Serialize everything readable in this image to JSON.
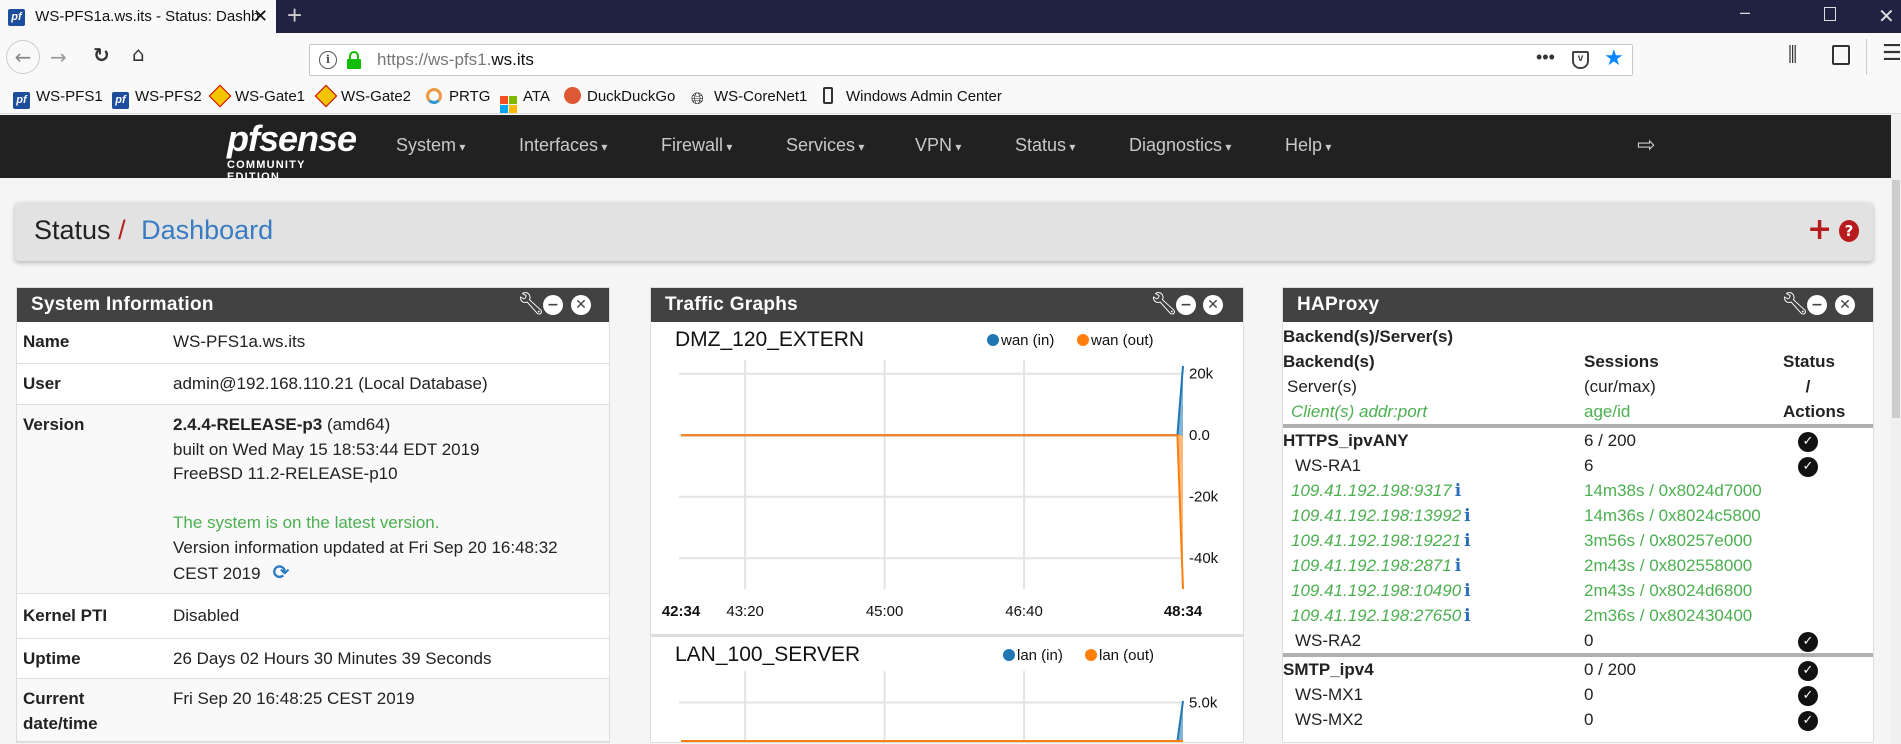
{
  "browser": {
    "tab_title": "WS-PFS1a.ws.its - Status: Dashb",
    "url_scheme": "https://ws-pfs1.",
    "url_domain": "ws.its",
    "bookmarks": [
      {
        "label": "WS-PFS1",
        "icon": "pfsense-icon"
      },
      {
        "label": "WS-PFS2",
        "icon": "pfsense-icon"
      },
      {
        "label": "WS-Gate1",
        "icon": "fritzbox-icon"
      },
      {
        "label": "WS-Gate2",
        "icon": "fritzbox-icon"
      },
      {
        "label": "PRTG",
        "icon": "prtg-icon"
      },
      {
        "label": "ATA",
        "icon": "windows-icon"
      },
      {
        "label": "DuckDuckGo",
        "icon": "duckduckgo-icon"
      },
      {
        "label": "WS-CoreNet1",
        "icon": "globe-icon"
      },
      {
        "label": "Windows Admin Center",
        "icon": "phone-icon"
      }
    ]
  },
  "nav": {
    "logo_text": "pfsense",
    "logo_sub": "COMMUNITY EDITION",
    "menu": [
      "System",
      "Interfaces",
      "Firewall",
      "Services",
      "VPN",
      "Status",
      "Diagnostics",
      "Help"
    ]
  },
  "breadcrumb": {
    "parent": "Status",
    "separator": "/",
    "current": "Dashboard"
  },
  "colors": {
    "accent": "#3a7cc3",
    "danger": "#b71c1c",
    "success": "#4caf50",
    "series_in": "#1f77b4",
    "series_out": "#ff7f0e"
  },
  "system_info": {
    "title": "System Information",
    "rows": [
      {
        "label": "Name",
        "lines": [
          "WS-PFS1a.ws.its"
        ]
      },
      {
        "label": "User",
        "lines": [
          "admin@192.168.110.21 (Local Database)"
        ]
      },
      {
        "label": "Version",
        "version_bold": "2.4.4-RELEASE-p3",
        "version_arch": " (amd64)",
        "built": "built on Wed May 15 18:53:44 EDT 2019",
        "os": "FreeBSD 11.2-RELEASE-p10",
        "status": "The system is on the latest version.",
        "updated_1": "Version information updated at Fri Sep 20 16:48:32",
        "updated_2": "CEST 2019"
      },
      {
        "label": "Kernel PTI",
        "lines": [
          "Disabled"
        ]
      },
      {
        "label": "Uptime",
        "lines": [
          "26 Days 02 Hours 30 Minutes 39 Seconds"
        ]
      },
      {
        "label_1": "Current",
        "label_2": "date/time",
        "lines": [
          "Fri Sep 20 16:48:25 CEST 2019"
        ]
      }
    ]
  },
  "traffic": {
    "title": "Traffic Graphs"
  },
  "chart_data": [
    {
      "type": "area",
      "title": "DMZ_120_EXTERN",
      "x_ticks": [
        "42:34",
        "43:20",
        "45:00",
        "46:40",
        "48:34"
      ],
      "x_range": [
        "42:34",
        "48:34"
      ],
      "y_ticks": [
        "20k",
        "0.0",
        "-20k",
        "-40k"
      ],
      "y_tick_values": [
        20000,
        0,
        -20000,
        -40000
      ],
      "ylim": [
        -50000,
        22500
      ],
      "grid": true,
      "legend_position": "top-right",
      "series": [
        {
          "name": "wan (in)",
          "color": "#1f77b4",
          "points": [
            [
              "42:34",
              0
            ],
            [
              "48:30",
              0
            ],
            [
              "48:34",
              22500
            ]
          ]
        },
        {
          "name": "wan (out)",
          "color": "#ff7f0e",
          "points": [
            [
              "42:34",
              0
            ],
            [
              "48:30",
              0
            ],
            [
              "48:34",
              -50000
            ]
          ]
        }
      ]
    },
    {
      "type": "area",
      "title": "LAN_100_SERVER",
      "x_range": [
        "42:34",
        "48:34"
      ],
      "y_ticks": [
        "5.0k"
      ],
      "y_tick_values": [
        5000
      ],
      "ylim": [
        0,
        5200
      ],
      "grid": true,
      "legend_position": "top-right",
      "series": [
        {
          "name": "lan (in)",
          "color": "#1f77b4",
          "points": [
            [
              "42:34",
              0
            ],
            [
              "48:30",
              0
            ],
            [
              "48:34",
              5200
            ]
          ]
        },
        {
          "name": "lan (out)",
          "color": "#ff7f0e",
          "points": [
            [
              "42:34",
              0
            ],
            [
              "48:34",
              0
            ]
          ]
        }
      ]
    }
  ],
  "haproxy": {
    "title": "HAProxy",
    "caption": "Backend(s)/Server(s)",
    "head": [
      {
        "c1": "Backend(s)",
        "c2": "Sessions",
        "c3": "Status",
        "kind": "bold"
      },
      {
        "c1": "Server(s)",
        "c2": "(cur/max)",
        "c3": "/",
        "kind": "server-head"
      },
      {
        "c1": "Client(s) addr:port",
        "c2": "age/id",
        "c3": "Actions",
        "kind": "client-head"
      }
    ],
    "groups": [
      {
        "rows": [
          {
            "kind": "backend",
            "c1": "HTTPS_ipvANY",
            "c2": "6 / 200",
            "ok": true
          },
          {
            "kind": "server",
            "c1": "WS-RA1",
            "c2": "6",
            "ok": true
          },
          {
            "kind": "client",
            "c1": "109.41.192.198:9317",
            "c2": "14m38s / 0x8024d7000"
          },
          {
            "kind": "client",
            "c1": "109.41.192.198:13992",
            "c2": "14m36s / 0x8024c5800"
          },
          {
            "kind": "client",
            "c1": "109.41.192.198:19221",
            "c2": "3m56s / 0x80257e000"
          },
          {
            "kind": "client",
            "c1": "109.41.192.198:2871",
            "c2": "2m43s / 0x802558000"
          },
          {
            "kind": "client",
            "c1": "109.41.192.198:10490",
            "c2": "2m43s / 0x8024d6800"
          },
          {
            "kind": "client",
            "c1": "109.41.192.198:27650",
            "c2": "2m36s / 0x802430400"
          },
          {
            "kind": "server",
            "c1": "WS-RA2",
            "c2": "0",
            "ok": true
          }
        ]
      },
      {
        "rows": [
          {
            "kind": "backend",
            "c1": "SMTP_ipv4",
            "c2": "0 / 200",
            "ok": true
          },
          {
            "kind": "server",
            "c1": "WS-MX1",
            "c2": "0",
            "ok": true
          },
          {
            "kind": "server",
            "c1": "WS-MX2",
            "c2": "0",
            "ok": true
          }
        ]
      }
    ]
  }
}
